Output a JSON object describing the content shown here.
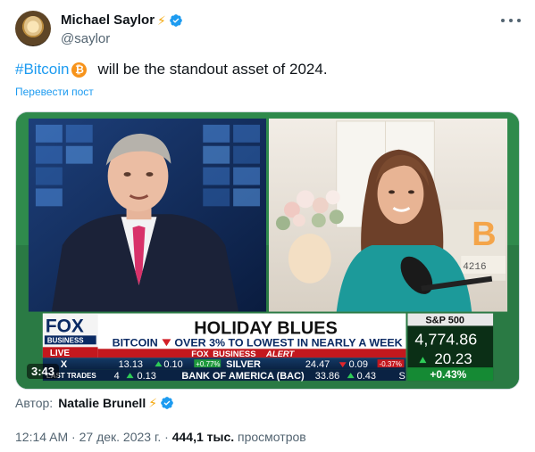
{
  "tweet": {
    "display_name": "Michael Saylor",
    "name_emoji": "⚡",
    "handle": "@saylor",
    "hashtag": "#Bitcoin",
    "btc_symbol": "₿",
    "text_rest": "will be the standout asset of 2024.",
    "translate_label": "Перевести пост",
    "more_icon": "more-icon",
    "verified_color": "#1d9bf0"
  },
  "media": {
    "duration": "3:43",
    "chyron": {
      "network_top": "FOX",
      "network_bottom": "BUSINESS",
      "live": "LIVE",
      "headline": "HOLIDAY BLUES",
      "subhead_left": "BITCOIN",
      "subhead_right": "OVER 3% TO LOWEST IN NEARLY A WEEK",
      "alert_prefix": "FOX",
      "alert_word": "BUSINESS",
      "alert_suffix": "ALERT",
      "index_name": "S&P 500",
      "index_value": "4,774.86",
      "index_change": "20.23",
      "index_pct": "+0.43%",
      "ticker1": {
        "left_partial": "X",
        "val1": "13.13",
        "chg1": "0.10",
        "pct1": "+0.77%",
        "name2": "SILVER",
        "val2": "24.47",
        "chg2": "0.09",
        "pct2": "-0.37%"
      },
      "ticker2": {
        "label": "LAST TRADES",
        "partial": "4",
        "chg": "0.13",
        "name": "BANK OF AMERICA (BAC)",
        "val": "33.86",
        "chg2": "0.43",
        "end": "S"
      },
      "bg_number": "4216",
      "bg_btc": "B"
    }
  },
  "author": {
    "label": "Автор:",
    "name": "Natalie Brunell",
    "emoji": "⚡"
  },
  "meta": {
    "time": "12:14 AM",
    "separator": "·",
    "date": "27 дек. 2023 г.",
    "views_count": "444,1 тыс.",
    "views_label": "просмотров"
  }
}
